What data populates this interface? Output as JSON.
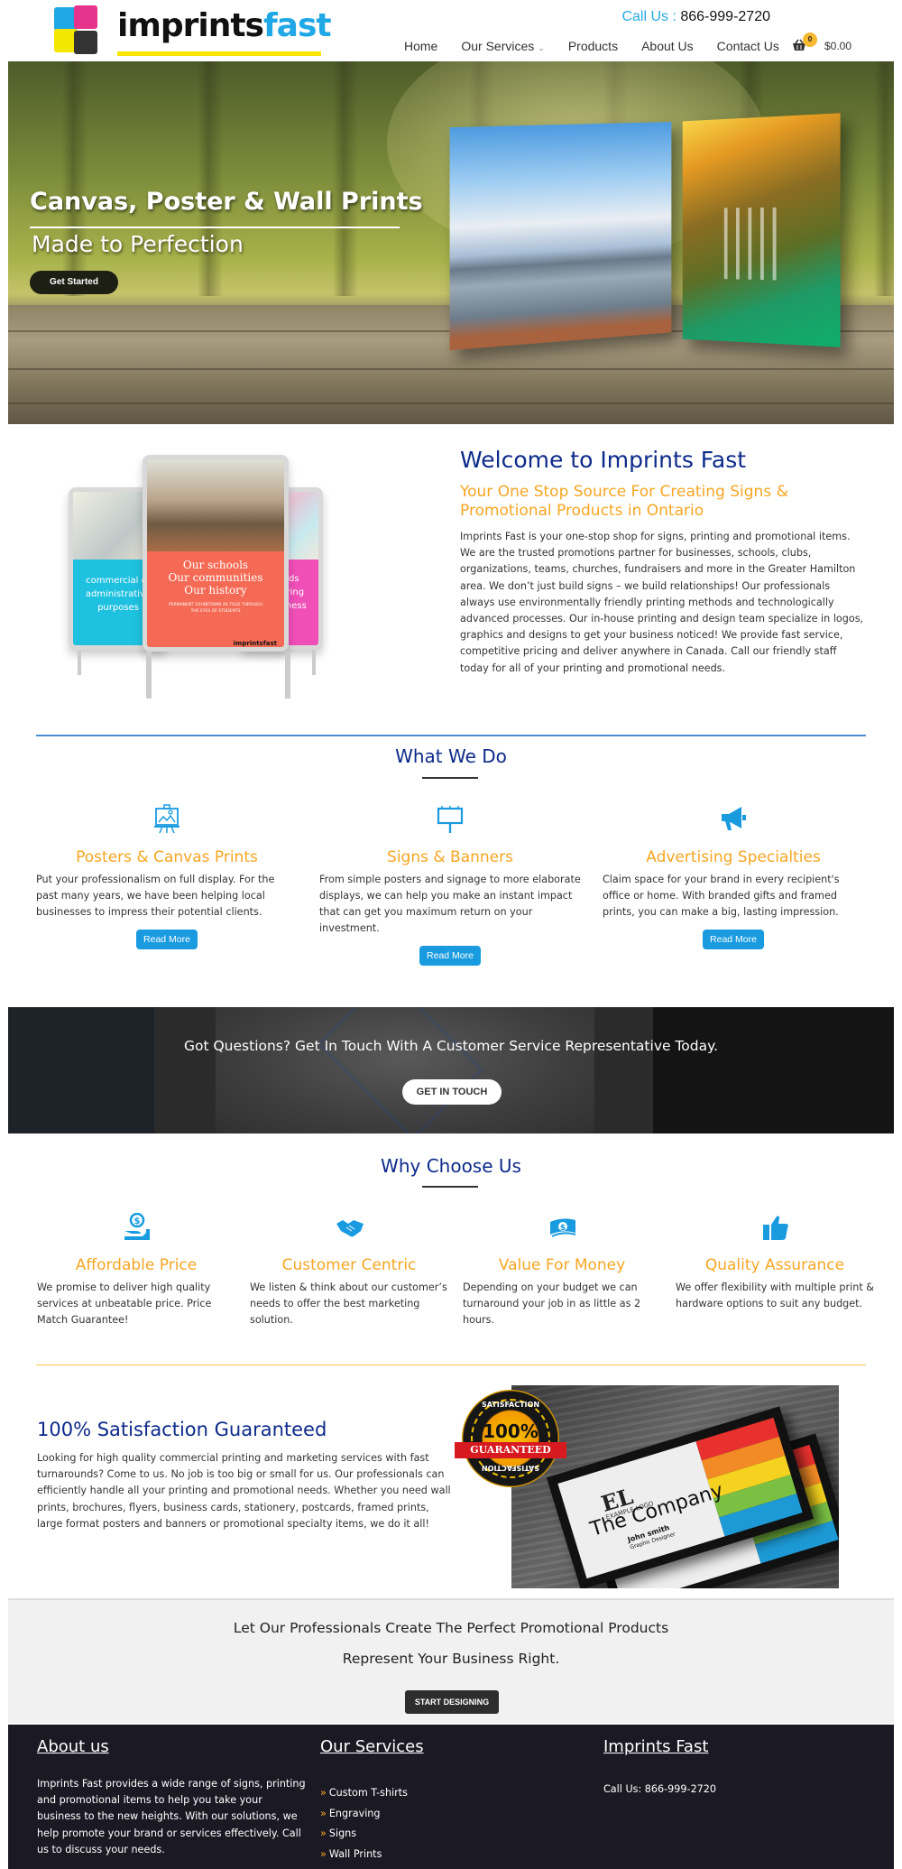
{
  "header": {
    "logo": {
      "part1": "imprints",
      "part2": "fast"
    },
    "call_label": "Call Us :",
    "phone": "866-999-2720",
    "nav": [
      {
        "label": "Home"
      },
      {
        "label": "Our Services",
        "has_dropdown": true
      },
      {
        "label": "Products"
      },
      {
        "label": "About Us"
      },
      {
        "label": "Contact Us"
      }
    ],
    "cart": {
      "count": "0",
      "total": "$0.00"
    },
    "chevron": "⌄"
  },
  "hero": {
    "title": "Canvas, Poster & Wall Prints",
    "subtitle": "Made to Perfection",
    "button": "Get Started"
  },
  "welcome": {
    "signs": {
      "left": "commercial or administrative purposes",
      "center_lines": [
        "Our schools",
        "Our communities",
        "Our history"
      ],
      "center_small": "PERMANENT EXHIBITIONS AS TOLD THROUGH THE EYES OF STUDENTS",
      "right": "cards bearing business",
      "brand": "imprintsfast"
    },
    "title": "Welcome to Imprints Fast",
    "subtitle": "Your One Stop Source For Creating Signs & Promotional Products in Ontario",
    "body": "Imprints Fast is your one-stop shop for signs, printing and promotional items. We are the trusted promotions partner for businesses, schools, clubs, organizations, teams, churches, fundraisers and more in the Greater Hamilton area. We don’t just build signs – we build relationships! Our professionals always use environmentally friendly printing methods and technologically advanced processes. Our in-house printing and design team specialize in logos, graphics and designs to get your business noticed! We provide fast service, competitive pricing and deliver anywhere in Canada. Call our friendly staff today for all of your printing and promotional needs."
  },
  "what_we_do": {
    "title": "What We Do",
    "services": [
      {
        "icon": "easel-icon",
        "title": "Posters & Canvas Prints",
        "desc": "Put your professionalism on full display. For the past many years, we have been helping local businesses to impress their potential clients.",
        "button": "Read More"
      },
      {
        "icon": "billboard-icon",
        "title": "Signs & Banners",
        "desc": "From simple posters and signage to more elaborate displays, we can help you make an instant impact that can get you maximum return on your investment.",
        "button": "Read More"
      },
      {
        "icon": "megaphone-icon",
        "title": "Advertising Specialties",
        "desc": "Claim space for your brand in every recipient's office or home. With branded gifts and framed prints, you can make a big, lasting impression.",
        "button": "Read More"
      }
    ]
  },
  "cta": {
    "text": "Got Questions? Get In Touch With A Customer Service Representative Today.",
    "button": "GET IN TOUCH"
  },
  "why_choose": {
    "title": "Why Choose Us",
    "items": [
      {
        "icon": "hand-coin-icon",
        "title": "Affordable Price",
        "desc": "We promise to deliver high quality services at unbeatable price. Price Match Guarantee!"
      },
      {
        "icon": "handshake-icon",
        "title": "Customer Centric",
        "desc": "We listen & think about our customer’s needs to offer the best marketing solution."
      },
      {
        "icon": "money-bill-icon",
        "title": "Value For Money",
        "desc": "Depending on your budget we can turnaround your job in as little as 2 hours."
      },
      {
        "icon": "thumbs-up-icon",
        "title": "Quality Assurance",
        "desc": "We offer flexibility with multiple print & hardware options to suit any budget."
      }
    ]
  },
  "satisfaction": {
    "title": "100% Satisfaction Guaranteed",
    "body": "Looking for high quality commercial printing and marketing services with fast turnarounds? Come to us. No job is too big or small for us. Our professionals can efficiently handle all your printing and promotional needs. Whether you need wall prints, brochures, flyers, business cards, stationery, postcards, framed prints, large format posters and banners or promotional specialty items, we do it all!",
    "seal": {
      "top": "SATISFACTION",
      "pct": "100%",
      "banner": "GUARANTEED",
      "bottom": "SATISFACTION"
    },
    "card": {
      "logo": "EL",
      "logo_text": "EXAMPLE LOGO",
      "company": "The Company",
      "name": "John smith",
      "role": "Graphic Designer"
    }
  },
  "promo": {
    "line1": "Let Our Professionals Create The Perfect Promotional Products",
    "line2": "Represent Your Business Right.",
    "button": "START DESIGNING"
  },
  "footer": {
    "about": {
      "heading": "About us",
      "text": "Imprints Fast provides a wide range of signs, printing and promotional items to help you take your business to the new heights. With our solutions, we help promote your brand or services effectively. Call us to discuss your needs."
    },
    "services": {
      "heading": "Our Services",
      "bullet": "»",
      "items": [
        "Custom T-shirts",
        "Engraving",
        "Signs",
        "Wall Prints"
      ]
    },
    "company": {
      "heading": "Imprints Fast",
      "phone_line": "Call Us: 866-999-2720"
    }
  },
  "colors": {
    "accent_blue": "#1a9be0",
    "heading_navy": "#0c2a8a",
    "accent_orange": "#f6a623",
    "footer_bg": "#1b1a24"
  }
}
